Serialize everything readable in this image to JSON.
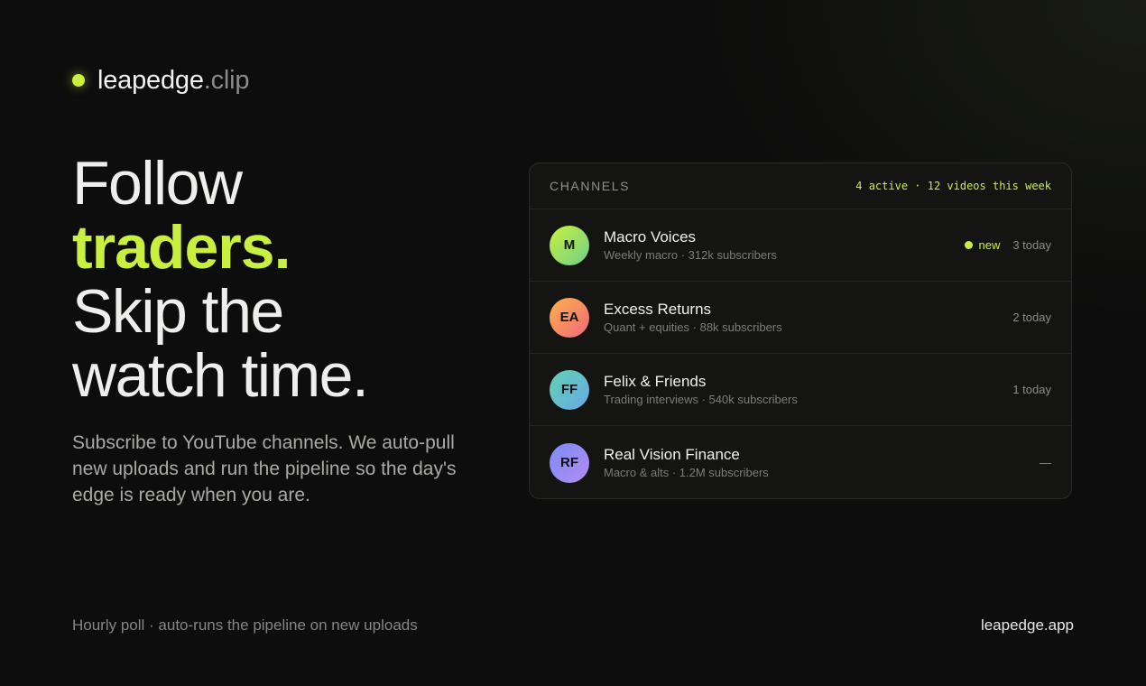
{
  "brand": {
    "name": "leapedge",
    "suffix": ".clip",
    "accent_color": "#c9f03e"
  },
  "headline": {
    "line1": "Follow",
    "line2": "traders.",
    "line3": "Skip the",
    "line4": "watch time."
  },
  "subtitle": "Subscribe to YouTube channels. We auto-pull new uploads and run the pipeline so the day's edge is ready when you are.",
  "panel": {
    "title": "CHANNELS",
    "summary": "4 active · 12 videos this week",
    "channels": [
      {
        "initials": "M",
        "name": "Macro Voices",
        "meta": "Weekly macro · 312k subscribers",
        "badge": "new",
        "status": "3 today",
        "gradient": [
          "#c9f03e",
          "#6fd08a"
        ]
      },
      {
        "initials": "EA",
        "name": "Excess Returns",
        "meta": "Quant + equities · 88k subscribers",
        "badge": "",
        "status": "2 today",
        "gradient": [
          "#ffb04a",
          "#f0697a"
        ]
      },
      {
        "initials": "FF",
        "name": "Felix & Friends",
        "meta": "Trading interviews · 540k subscribers",
        "badge": "",
        "status": "1 today",
        "gradient": [
          "#5fd3b0",
          "#6aa8e8"
        ]
      },
      {
        "initials": "RF",
        "name": "Real Vision Finance",
        "meta": "Macro & alts · 1.2M subscribers",
        "badge": "",
        "status": "—",
        "gradient": [
          "#7b8cf5",
          "#b38cf0"
        ]
      }
    ]
  },
  "footer": {
    "left": "Hourly poll · auto-runs the pipeline on new uploads",
    "right": "leapedge.app"
  }
}
